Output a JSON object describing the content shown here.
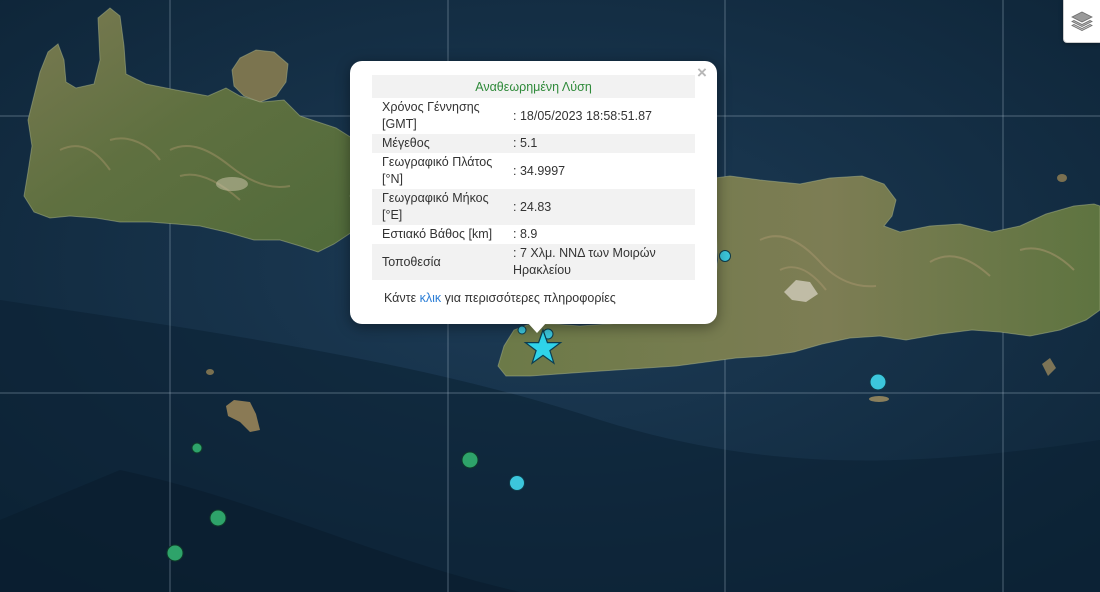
{
  "popup": {
    "title": "Αναθεωρημένη Λύση",
    "close_label": "×",
    "rows": [
      {
        "label": "Χρόνος Γέννησης [GMT]",
        "value": ": 18/05/2023 18:58:51.87"
      },
      {
        "label": "Μέγεθος",
        "value": ": 5.1"
      },
      {
        "label": "Γεωγραφικό Πλάτος [°N]",
        "value": ": 34.9997"
      },
      {
        "label": "Γεωγραφικό Μήκος [°E]",
        "value": ": 24.83"
      },
      {
        "label": "Εστιακό Βάθος [km]",
        "value": ": 8.9"
      },
      {
        "label": "Τοποθεσία",
        "value": ": 7 Χλμ. ΝΝΔ των Μοιρών Ηρακλείου"
      }
    ],
    "footer_prefix": "Κάντε ",
    "footer_link": "κλικ",
    "footer_suffix": " για περισσότερες πληροφορίες"
  },
  "controls": {
    "layers_icon": "layers-icon"
  },
  "colors": {
    "sea": "#153149",
    "land": "#6a7a4a",
    "quake_cyan": "#3cc6dc",
    "quake_green": "#2ea36a",
    "epicenter_star": "#2fd3ea",
    "popup_title": "#2f8a3a",
    "link": "#2a7dd6"
  },
  "markers": [
    {
      "type": "epicenter-star",
      "lon": 24.83,
      "lat": 34.9997
    },
    {
      "type": "quake",
      "color": "cyan"
    },
    {
      "type": "quake",
      "color": "cyan"
    },
    {
      "type": "quake",
      "color": "cyan"
    },
    {
      "type": "quake",
      "color": "green"
    },
    {
      "type": "quake",
      "color": "green"
    },
    {
      "type": "quake",
      "color": "green"
    },
    {
      "type": "quake",
      "color": "green"
    }
  ]
}
